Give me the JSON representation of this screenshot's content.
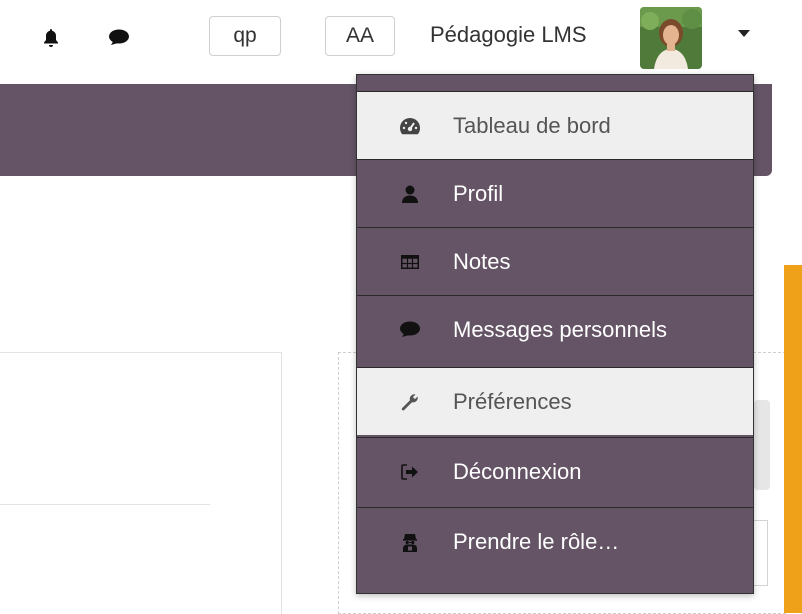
{
  "navbar": {
    "notifications_icon": "bell-icon",
    "messages_icon": "chat-bubble-icon",
    "btn_qp": "qp",
    "btn_aa": "AA",
    "user_name": "Pédagogie LMS",
    "caret_icon": "chevron-down-icon"
  },
  "user_menu": {
    "items": [
      {
        "label": "Tableau de bord",
        "icon": "dashboard-icon",
        "highlight": true
      },
      {
        "label": "Profil",
        "icon": "user-icon",
        "highlight": false
      },
      {
        "label": "Notes",
        "icon": "table-icon",
        "highlight": false
      },
      {
        "label": "Messages personnels",
        "icon": "chat-bubble-icon",
        "highlight": false
      },
      {
        "label": "Préférences",
        "icon": "wrench-icon",
        "highlight": true
      },
      {
        "label": "Déconnexion",
        "icon": "sign-out-icon",
        "highlight": false
      },
      {
        "label": "Prendre le rôle…",
        "icon": "user-secret-icon",
        "highlight": false
      }
    ]
  },
  "colors": {
    "header_band": "#645465",
    "menu_bg": "#645465",
    "menu_highlight_bg": "#efefef",
    "accent_strip": "#f0a11a"
  }
}
